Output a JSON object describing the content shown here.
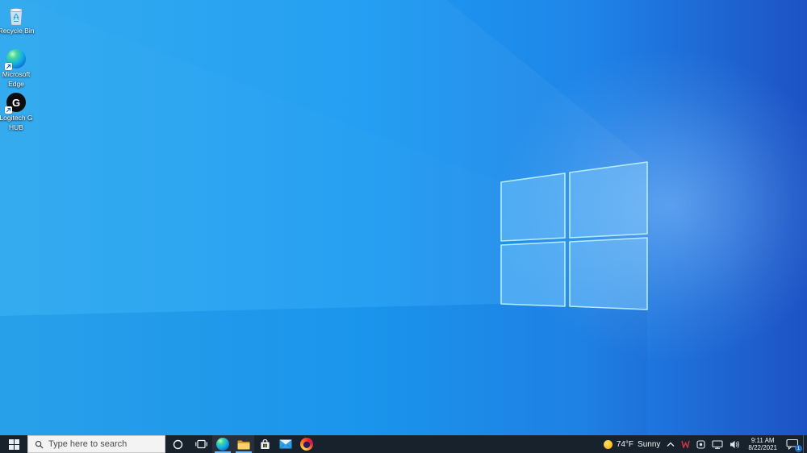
{
  "desktop": {
    "icons": [
      {
        "name": "recycle-bin",
        "label_line1": "Recycle Bin",
        "label_line2": ""
      },
      {
        "name": "microsoft-edge",
        "label_line1": "Microsoft",
        "label_line2": "Edge"
      },
      {
        "name": "logitech-g-hub",
        "label_line1": "Logitech G",
        "label_line2": "HUB"
      }
    ]
  },
  "taskbar": {
    "search": {
      "placeholder": "Type here to search"
    },
    "pinned_apps": [
      "Microsoft Edge",
      "File Explorer",
      "Microsoft Store",
      "Mail",
      "Firefox"
    ],
    "open_apps": [
      "Microsoft Edge",
      "File Explorer"
    ],
    "tray": {
      "weather_temp": "74°F",
      "weather_condition": "Sunny",
      "clock_time": "9:11 AM",
      "clock_date": "8/22/2021",
      "notification_badge": "1"
    },
    "tray_icon_names": [
      "hidden-icons-chevron",
      "red-w-tray-icon",
      "app-tray-icon",
      "network-icon",
      "volume-icon",
      "action-center-icon"
    ]
  },
  "colors": {
    "taskbar_bg": "#18222d",
    "open_app_underline": "#76b9ed",
    "wallpaper_left": "#28a6f0",
    "wallpaper_right": "#1d55c6",
    "logo_stroke": "#b5ecfd"
  }
}
